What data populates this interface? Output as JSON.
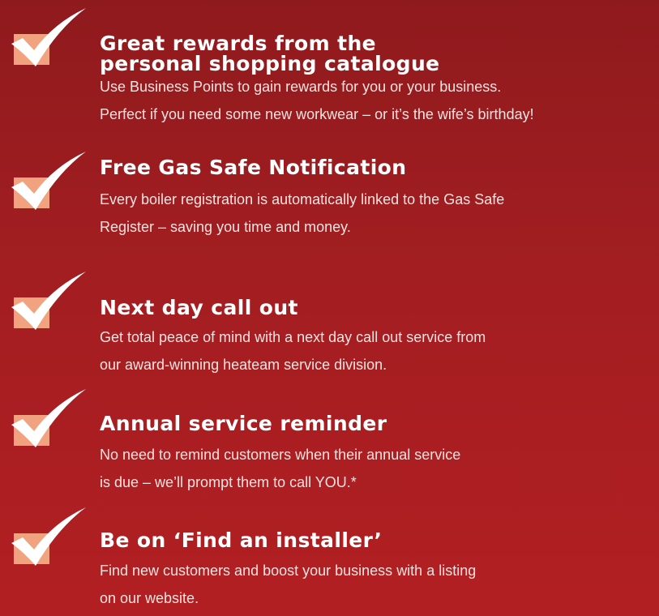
{
  "benefits": [
    {
      "icon": "checkmark-icon",
      "title_lines": [
        "Great rewards from the",
        "personal shopping catalogue"
      ],
      "desc_lines": [
        "Use Business Points to gain rewards for you or your business.",
        "Perfect if you need some new workwear – or it’s the wife’s birthday!"
      ]
    },
    {
      "icon": "checkmark-icon",
      "title_lines": [
        "Free Gas Safe Notification"
      ],
      "desc_lines": [
        "Every boiler registration is automatically linked to the Gas Safe",
        "Register – saving you time and money."
      ]
    },
    {
      "icon": "checkmark-icon",
      "title_lines": [
        "Next day call out"
      ],
      "desc_lines": [
        "Get total peace of mind with a next day call out service from",
        "our award-winning heateam service division."
      ]
    },
    {
      "icon": "checkmark-icon",
      "title_lines": [
        "Annual service reminder"
      ],
      "desc_lines": [
        "No need to remind customers when their annual service",
        "is due – we’ll prompt them to call YOU.*"
      ]
    },
    {
      "icon": "checkmark-icon",
      "title_lines": [
        "Be on ‘Find an installer’"
      ],
      "desc_lines": [
        "Find new customers and boost your business with a listing",
        "on our website."
      ]
    }
  ],
  "colors": {
    "background_top": "#8f1a1d",
    "background_bottom": "#b21f22",
    "checkbox_fill": "#f0a37e",
    "checkmark": "#ffffff",
    "text": "#ffffff"
  }
}
